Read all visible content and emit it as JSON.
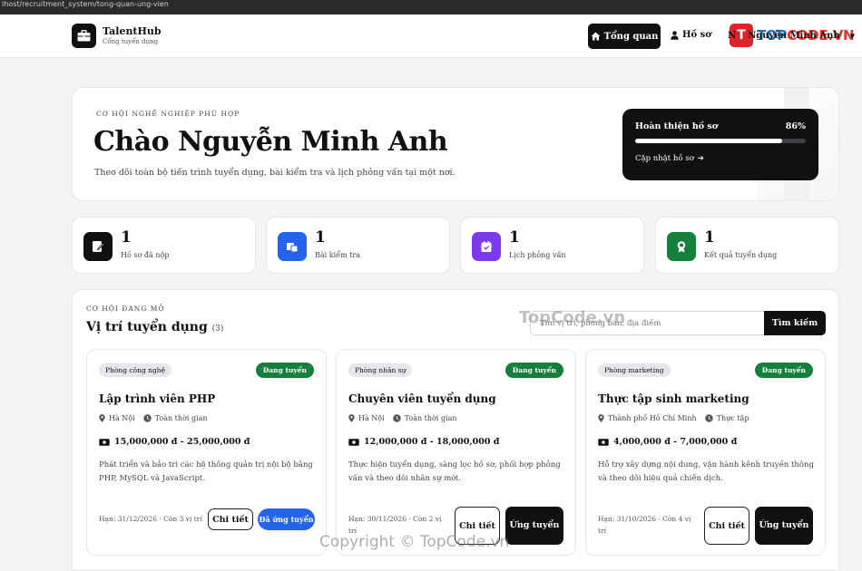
{
  "browser": {
    "url": "lhost/recruitment_system/tong-quan-ung-vien"
  },
  "brand": {
    "name": "TalentHub",
    "subtitle": "Cổng tuyển dụng"
  },
  "nav": {
    "overview": "Tổng quan",
    "profile": "Hồ sơ",
    "user_initial": "N",
    "user_name": "Nguyễn Minh Anh"
  },
  "watermark": {
    "logo_letter": "T",
    "logo_prefix": "TOP",
    "logo_suffix": "CODE.VN",
    "center": "TopCode.vn",
    "bottom": "Copyright © TopCode.vn"
  },
  "hero": {
    "eyebrow": "CƠ HỘI NGHỀ NGHIỆP PHÙ HỢP",
    "title": "Chào Nguyễn Minh Anh",
    "description": "Theo dõi toàn bộ tiến trình tuyển dụng, bài kiểm tra và lịch phỏng vấn tại một nơi.",
    "progress": {
      "label": "Hoàn thiện hồ sơ",
      "percent_text": "86%",
      "value": 0.86,
      "link": "Cập nhật hồ sơ"
    }
  },
  "stats": [
    {
      "value": "1",
      "label": "Hồ sơ đã nộp",
      "icon": "file-edit-icon",
      "color": "#111111"
    },
    {
      "value": "1",
      "label": "Bài kiểm tra",
      "icon": "test-icon",
      "color": "#2563eb"
    },
    {
      "value": "1",
      "label": "Lịch phỏng vấn",
      "icon": "calendar-check-icon",
      "color": "#7c3aed"
    },
    {
      "value": "1",
      "label": "Kết quả tuyển dụng",
      "icon": "award-icon",
      "color": "#157f3c"
    }
  ],
  "jobs": {
    "eyebrow": "CƠ HỘI ĐANG MỞ",
    "title": "Vị trí tuyển dụng",
    "count": "(3)",
    "search": {
      "placeholder": "Tìm vị trí, phòng ban, địa điểm",
      "button": "Tìm kiếm"
    },
    "items": [
      {
        "department": "Phòng công nghệ",
        "status": "Đang tuyển",
        "title": "Lập trình viên PHP",
        "location": "Hà Nội",
        "type": "Toàn thời gian",
        "salary": "15,000,000 đ - 25,000,000 đ",
        "description": "Phát triển và bảo trì các hệ thống quản trị nội bộ bằng PHP, MySQL và JavaScript.",
        "deadline": "Hạn: 31/12/2026 · Còn 3 vị trí",
        "detail": "Chi tiết",
        "apply": "Đã ứng tuyển"
      },
      {
        "department": "Phòng nhân sự",
        "status": "Đang tuyển",
        "title": "Chuyên viên tuyển dụng",
        "location": "Hà Nội",
        "type": "Toàn thời gian",
        "salary": "12,000,000 đ - 18,000,000 đ",
        "description": "Thực hiện tuyển dụng, sàng lọc hồ sơ, phối hợp phỏng vấn và theo dõi nhân sự mới.",
        "deadline": "Hạn: 30/11/2026 · Còn 2 vị trí",
        "detail": "Chi tiết",
        "apply": "Ứng tuyển"
      },
      {
        "department": "Phòng marketing",
        "status": "Đang tuyển",
        "title": "Thực tập sinh marketing",
        "location": "Thành phố Hồ Chí Minh",
        "type": "Thực tập",
        "salary": "4,000,000 đ - 7,000,000 đ",
        "description": "Hỗ trợ xây dựng nội dung, vận hành kênh truyền thông và theo dõi hiệu quả chiến dịch.",
        "deadline": "Hạn: 31/10/2026 · Còn 4 vị trí",
        "detail": "Chi tiết",
        "apply": "Ứng tuyển"
      }
    ]
  }
}
